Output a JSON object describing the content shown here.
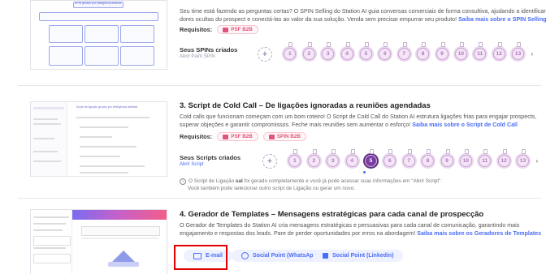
{
  "section2": {
    "para_line1": "Seu time está fazendo as perguntas certas? O SPIN Selling do Station AI guia conversas comerciais de forma consultiva, ajudando a identificar",
    "para_line2": "dores ocultas do prospect e conectá-las ao valor da sua solução. Venda sem precisar empurrar seu produto!",
    "link": "Saiba mais sobre o SPIN Selling",
    "requisitos_label": "Requisitos:",
    "tags": [
      "PSF B2B"
    ],
    "row_title": "Seus SPINs criados",
    "row_sub": "Abrir Paint SPIN",
    "numbers": [
      "1",
      "2",
      "3",
      "4",
      "5",
      "6",
      "7",
      "8",
      "9",
      "10",
      "11",
      "12",
      "13"
    ],
    "thumb_title": "SPIN gerado por inteligência artificial"
  },
  "section3": {
    "heading": "3. Script de Cold Call – De ligações ignoradas a reuniões agendadas",
    "para_line1": "Cold calls que funcionam começam com um bom roteiro! O Script de Cold Call do Station AI estrutura ligações frias para engajar prospects,",
    "para_line2": "superar objeções e garantir compromissos. Feche mais reuniões sem aumentar o esforço!",
    "link": "Saiba mais sobre o Script de Cold Call",
    "requisitos_label": "Requisitos:",
    "tags": [
      "PSF B2B",
      "SPIN B2B"
    ],
    "row_title": "Seus Scripts criados",
    "row_sub": "Abrir Script",
    "numbers": [
      "1",
      "2",
      "3",
      "4",
      "5",
      "6",
      "7",
      "8",
      "9",
      "10",
      "11",
      "12",
      "13"
    ],
    "active_number": "5",
    "note_pre": "O Script de Ligação ",
    "note_bold": "sal",
    "note_post": " foi gerado completamente e você já pode acessar suas informações em \"Abrir Script\".",
    "note_line2": "Você também pode selecionar outro script de Ligação ou gerar um novo.",
    "thumb_title": "Script de ligação gerado por inteligência artificial"
  },
  "section4": {
    "heading": "4. Gerador de Templates – Mensagens estratégicas para cada canal de prospecção",
    "para_line1": "O Gerador de Templates do Station AI cria mensagens estratégicas e persuasivas para cada canal de comunicação, garantindo mais",
    "para_line2": "engajamento e respostas dos leads. Pare de perder oportunidades por erros na abordagem!",
    "link": "Saiba mais sobre os Geradores de Templates",
    "buttons": [
      "E-mail",
      "Social Point (WhatsApp)",
      "Social Point (Linkedin)"
    ]
  },
  "colors": {
    "accent": "#4a6cf7",
    "tag_pink": "#e2537a",
    "bubble": "#ead7ee",
    "active_bubble": "#5b2e7c",
    "highlight_box": "#e00000"
  }
}
